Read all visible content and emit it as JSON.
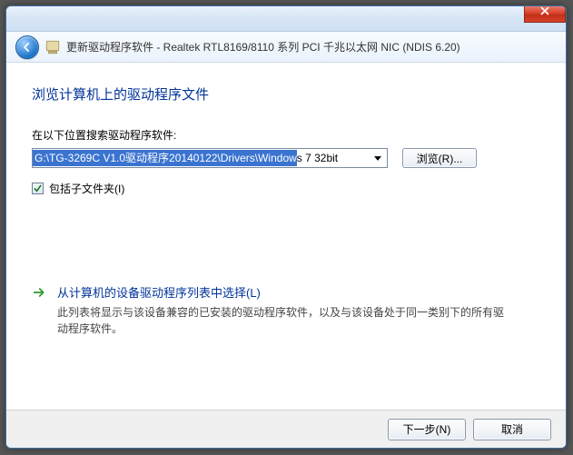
{
  "window": {
    "title": "更新驱动程序软件 - Realtek RTL8169/8110 系列 PCI 千兆以太网 NIC (NDIS 6.20)"
  },
  "content": {
    "heading": "浏览计算机上的驱动程序文件",
    "search_label": "在以下位置搜索驱动程序软件:",
    "path_selected": "G:\\TG-3269C V1.0驱动程序20140122\\Drivers\\Window",
    "path_rest": "s 7 32bit",
    "browse_label": "浏览(R)...",
    "include_subfolders_label": "包括子文件夹(I)",
    "include_subfolders_checked": true,
    "option": {
      "title": "从计算机的设备驱动程序列表中选择(L)",
      "desc": "此列表将显示与该设备兼容的已安装的驱动程序软件，以及与该设备处于同一类别下的所有驱动程序软件。"
    }
  },
  "footer": {
    "next_label": "下一步(N)",
    "cancel_label": "取消"
  }
}
